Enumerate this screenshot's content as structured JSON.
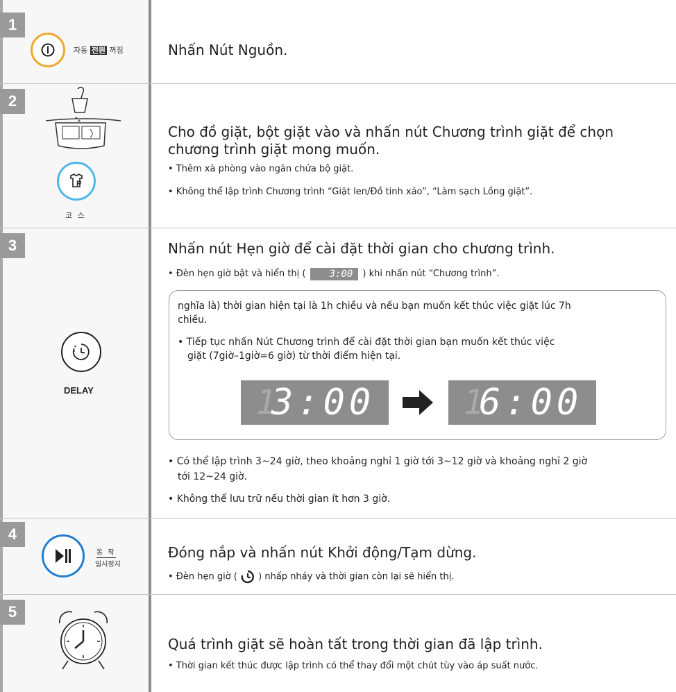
{
  "steps": [
    {
      "number": "1",
      "title": "Nhấn Nút Nguồn.",
      "icon_label": {
        "pre": "자동",
        "boxed": "전원",
        "post": "꺼짐"
      }
    },
    {
      "number": "2",
      "title_line1": "Cho đồ giặt, bột giặt vào và nhấn nút Chương trình giặt để chọn",
      "title_line2": "chương trình giặt mong muốn.",
      "bullets": [
        "• Thêm xà phòng vào ngăn chứa bộ giặt.",
        "• Không thể lập trình Chương trình “Giặt  len/Đồ tinh xảo”, “Làm sạch Lồng giặt”."
      ],
      "icon_label": "코 스"
    },
    {
      "number": "3",
      "title": "Nhấn nút Hẹn giờ để cài đặt thời gian cho chương trình.",
      "bullet1_pre": "• Đèn hẹn giờ bật và hiển thị (",
      "bullet1_display": "3:00",
      "bullet1_post": ") khi nhấn nút “Chương trình”.",
      "box_line1": "nghĩa là) thời gian hiện tại là 1h chiều và nếu bạn muốn kết thúc việc giặt lúc 7h",
      "box_line2": "chiều.",
      "box_bullet_line1": "• Tiếp tục nhấn Nút Chương trình để cài đặt thời gian bạn muốn kết thúc việc",
      "box_bullet_line2": "giặt (7giờ–1giờ=6 giờ) từ thời điểm hiện tại.",
      "display_before": "3:00",
      "display_after": "6:00",
      "bullet2_line1": "• Có thể lập trình 3~24 giờ, theo khoảng nghỉ 1 giờ tới 3~12 giờ và khoảng nghỉ 2 giờ",
      "bullet2_line2": "tới 12~24 giờ.",
      "bullet3": "• Không thể lưu trữ nếu thời gian ít hơn 3 giờ.",
      "icon_label": "DELAY"
    },
    {
      "number": "4",
      "title": "Đóng nắp và nhấn nút Khởi động/Tạm dừng.",
      "bullet_pre": "• Đèn hẹn giờ (",
      "bullet_post": ") nhấp nháy và thời gian còn lại sẽ hiển thị.",
      "icon_label_top": "동 작",
      "icon_label_bottom": "일시정지"
    },
    {
      "number": "5",
      "title": "Quá trình giặt sẽ hoàn tất trong thời gian đã lập trình.",
      "bullet": "• Thời gian kết thúc được lập trình có thể thay đổi một chút tùy vào áp suất nước."
    }
  ],
  "colors": {
    "power_ring": "#f0a830",
    "course_ring": "#4db8e8",
    "start_ring": "#1f7fd0",
    "badge": "#9a9a9a",
    "display": "#8d8d8d"
  },
  "icons": [
    "power-icon",
    "detergent-icon",
    "course-icon",
    "delay-clock-icon",
    "play-pause-icon",
    "arrow-right-icon",
    "alarm-clock-icon"
  ]
}
